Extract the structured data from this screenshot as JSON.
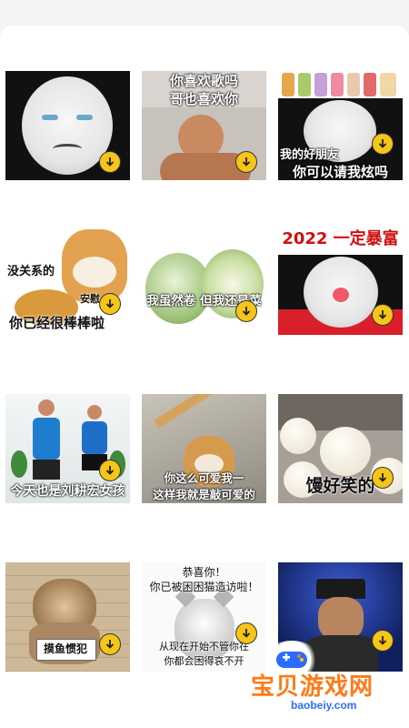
{
  "download_icon": "download-arrow-icon",
  "memes": [
    {
      "captions": []
    },
    {
      "captions": [
        "你喜欢歌吗",
        "哥也喜欢你"
      ]
    },
    {
      "captions": [
        "我的好朋友",
        "你可以请我炫吗"
      ]
    },
    {
      "captions": [
        "没关系的",
        "安慰",
        "你已经很棒棒啦"
      ]
    },
    {
      "captions": [
        "我虽然卷 但我还是菜"
      ]
    },
    {
      "captions": [
        "2022  一定暴富"
      ]
    },
    {
      "captions": [
        "今天也是刘耕宏女孩"
      ]
    },
    {
      "captions": [
        "你这么可爱我一",
        "这样我就是敲可爱的"
      ]
    },
    {
      "captions": [
        "馒好笑的"
      ]
    },
    {
      "captions": [
        "摸鱼惯犯"
      ]
    },
    {
      "captions": [
        "恭喜你！",
        "你已被困困猫造访啦！",
        "从现在开始不管你在",
        "你都会困得哀不开"
      ]
    },
    {
      "captions": []
    }
  ],
  "watermark": {
    "title": "宝贝游戏网",
    "url": "baobeiy.com"
  },
  "colors": {
    "download_badge": "#f5c518",
    "watermark_orange": "#ff7a18",
    "watermark_blue": "#2b6cff"
  }
}
